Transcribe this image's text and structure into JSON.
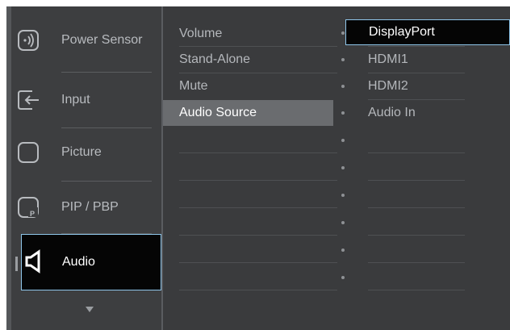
{
  "menu": {
    "items": [
      {
        "label": "Power Sensor",
        "icon": "power-sensor-icon"
      },
      {
        "label": "Input",
        "icon": "input-icon"
      },
      {
        "label": "Picture",
        "icon": "picture-icon"
      },
      {
        "label": "PIP / PBP",
        "icon": "pip-icon"
      },
      {
        "label": "Audio",
        "icon": "audio-icon"
      }
    ],
    "active": "Audio"
  },
  "submenu": {
    "items": [
      "Volume",
      "Stand-Alone",
      "Mute",
      "Audio Source"
    ],
    "selected": "Audio Source"
  },
  "options": {
    "items": [
      "DisplayPort",
      "HDMI1",
      "HDMI2",
      "Audio In"
    ],
    "selected": "DisplayPort"
  },
  "colors": {
    "background": "#3a3b3d",
    "highlight_border": "#8fc6ea",
    "selected_fill": "#050505"
  }
}
